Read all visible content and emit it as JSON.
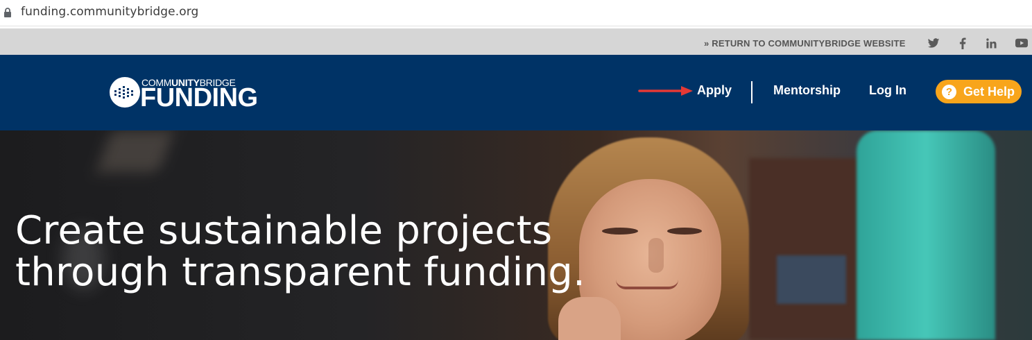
{
  "browser": {
    "url": "funding.communitybridge.org"
  },
  "utility_bar": {
    "return_link": "» RETURN TO COMMUNITYBRIDGE WEBSITE",
    "social_icons": [
      "twitter-icon",
      "facebook-icon",
      "linkedin-icon",
      "youtube-icon"
    ]
  },
  "header": {
    "logo": {
      "prefix": "COMM",
      "bold": "UNITY",
      "suffix": "BRIDGE",
      "main": "FUNDING"
    },
    "nav": {
      "apply": "Apply",
      "mentorship": "Mentorship",
      "login": "Log In",
      "help": "Get Help",
      "help_icon": "?"
    },
    "colors": {
      "background": "#003366",
      "help_button": "#f8a51b",
      "annotation_arrow": "#e53935"
    }
  },
  "hero": {
    "title_line1": "Create sustainable projects",
    "title_line2": "through transparent funding."
  }
}
